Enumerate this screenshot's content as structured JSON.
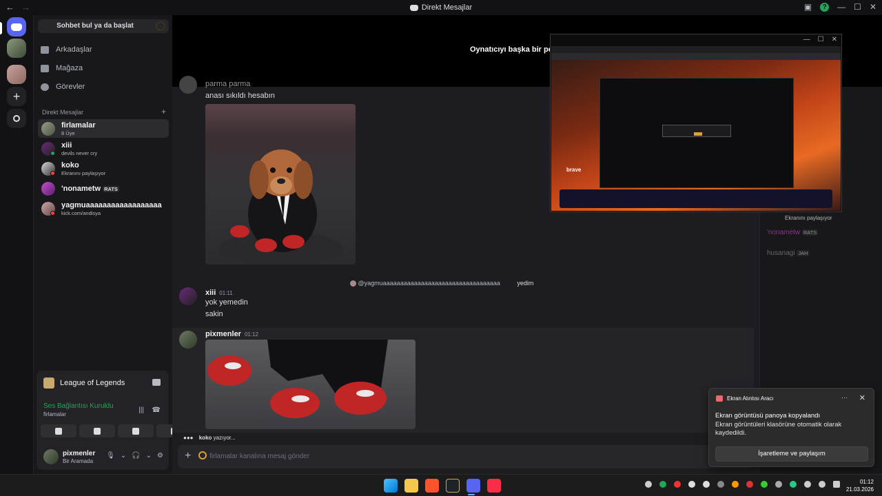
{
  "window": {
    "title": "Direkt Mesajlar",
    "back": "←",
    "forward": "→"
  },
  "search": {
    "label": "Sohbet bul ya da başlat"
  },
  "nav": [
    {
      "label": "Arkadaşlar"
    },
    {
      "label": "Mağaza"
    },
    {
      "label": "Görevler"
    }
  ],
  "dm_header": {
    "label": "Direkt Mesajlar",
    "add": "+"
  },
  "dms": [
    {
      "name": "firlamalar",
      "sub": "8 Üye"
    },
    {
      "name": "xiii",
      "sub": "devils never cry"
    },
    {
      "name": "koko",
      "sub": "Ekranını paylaşıyor"
    },
    {
      "name": "'nonametw",
      "tag": "RATS"
    },
    {
      "name": "yagmuaaaaaaaaaaaaaaaaaa",
      "sub": "kick.com/andisya"
    }
  ],
  "activity": {
    "game": "League of Legends",
    "voice_status": "Ses Bağlantısı Kuruldu",
    "voice_channel": "firlamalar"
  },
  "user": {
    "name": "pixmenler",
    "status": "Bir Aramada"
  },
  "stream": {
    "text": "Oynatıcıyı başka bir pence"
  },
  "messages": {
    "cut_line": "parma parma",
    "line1": "anası sıkıldı hesabın",
    "reply_to": "@yagmuaaaaaaaaaaaaaaaaaaaaaaaaaaaaaaaaaa",
    "reply_preview": "yedim",
    "xiii_author": "xiii",
    "xiii_time": "01:11",
    "xiii_line1": "yok yemedin",
    "xiii_line2": "sakin",
    "pix_author": "pixmenler",
    "pix_time": "01:12"
  },
  "typing": {
    "user": "koko",
    "text": "yazıyor..."
  },
  "composer": {
    "placeholder": "firlamalar kanalına mesaj gönder",
    "plus": "+"
  },
  "members_partial": [
    {
      "text": "Ekranını paylaşıyor"
    },
    {
      "text": "'nonametw",
      "tag": "RATS"
    },
    {
      "text": "husanagi",
      "tag": "JAH"
    }
  ],
  "pip": {
    "brave_label": "brave",
    "controls": {
      "minimize": "—",
      "maximize": "☐",
      "close": "✕"
    }
  },
  "toast": {
    "app": "Ekran Alıntısı Aracı",
    "more": "···",
    "close": "✕",
    "heading": "Ekran görüntüsü panoya kopyalandı",
    "body": "Ekran görüntüleri klasörüne otomatik olarak kaydedildi.",
    "button": "İşaretleme ve paylaşım"
  },
  "clock": {
    "time": "01:12",
    "date": "21.03.2026"
  },
  "colors": {
    "accent": "#5865f2",
    "online": "#23a55a",
    "dnd": "#f23f43"
  }
}
